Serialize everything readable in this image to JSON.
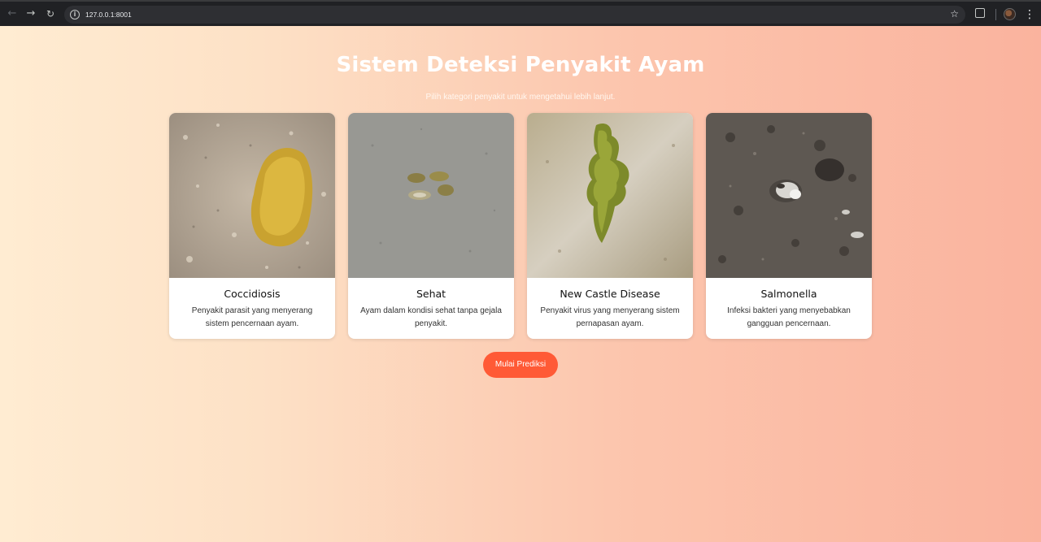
{
  "browser": {
    "url": "127.0.0.1:8001",
    "icons": [
      "back-icon",
      "forward-icon",
      "reload-icon",
      "info-icon",
      "star-icon",
      "extensions-icon",
      "profile-avatar",
      "menu-icon"
    ]
  },
  "page": {
    "title": "Sistem Deteksi Penyakit Ayam",
    "subtitle": "Pilih kategori penyakit untuk mengetahui lebih lanjut.",
    "predict_button": "Mulai Prediksi"
  },
  "cards": [
    {
      "title": "Coccidiosis",
      "description": "Penyakit parasit yang menyerang sistem pencernaan ayam."
    },
    {
      "title": "Sehat",
      "description": "Ayam dalam kondisi sehat tanpa gejala penyakit."
    },
    {
      "title": "New Castle Disease",
      "description": "Penyakit virus yang menyerang sistem pernapasan ayam."
    },
    {
      "title": "Salmonella",
      "description": "Infeksi bakteri yang menyebabkan gangguan pencernaan."
    }
  ],
  "colors": {
    "accent": "#ff5a36",
    "gradient_start": "#ffecd2",
    "gradient_end": "#fab39e"
  }
}
